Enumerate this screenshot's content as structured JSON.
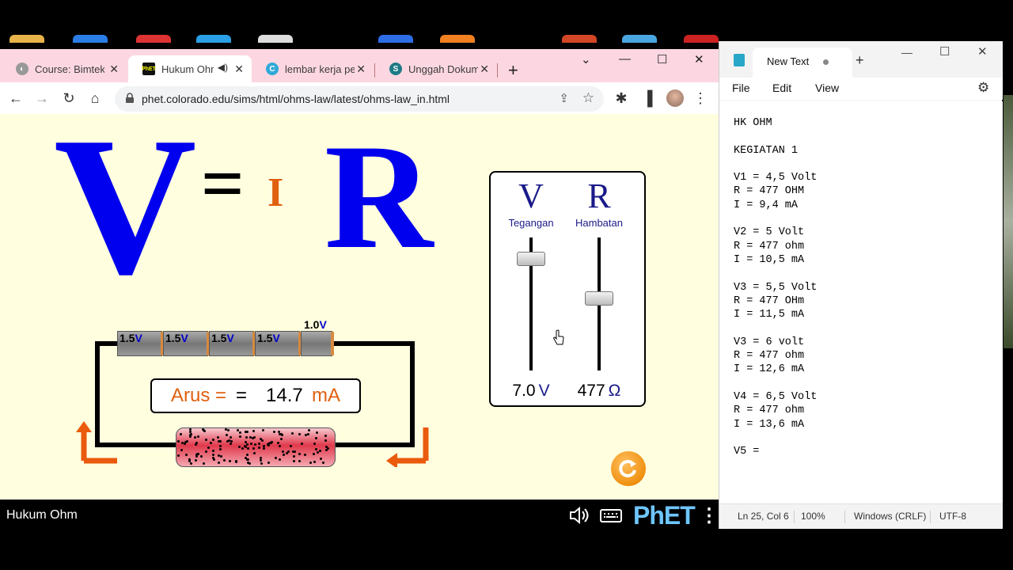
{
  "browser": {
    "tabs": [
      {
        "title": "Course: Bimtek I",
        "favicon": "course-icon",
        "active": false
      },
      {
        "title": "Hukum Ohm",
        "favicon": "phet-icon",
        "active": true,
        "audio": true
      },
      {
        "title": "lembar kerja pe",
        "favicon": "canva-icon",
        "active": false
      },
      {
        "title": "Unggah Dokum",
        "favicon": "scribd-icon",
        "active": false
      }
    ],
    "url": "phet.colorado.edu/sims/html/ohms-law/latest/ohms-law_in.html"
  },
  "sim": {
    "equation": {
      "v": "V",
      "eq": "=",
      "i": "I",
      "r": "R"
    },
    "voltage": {
      "letter": "V",
      "name": "Tegangan",
      "value": "7.0",
      "unit": "V",
      "fraction": 0.84
    },
    "resistance": {
      "letter": "R",
      "name": "Hambatan",
      "value": "477",
      "unit": "Ω",
      "fraction": 0.54
    },
    "batteries": [
      "1.5",
      "1.5",
      "1.5",
      "1.5"
    ],
    "battery_unit": "V",
    "partial_battery": "1.0",
    "current": {
      "label": "Arus =",
      "eq": "=",
      "value": "14.7",
      "unit": "mA"
    },
    "title": "Hukum Ohm",
    "brand": "PhET"
  },
  "notepad": {
    "tab_title": "New Text",
    "menu": [
      "File",
      "Edit",
      "View"
    ],
    "content": "HK OHM\n\nKEGIATAN 1\n\nV1 = 4,5 Volt\nR = 477 OHM\nI = 9,4 mA\n\nV2 = 5 Volt\nR = 477 ohm\nI = 10,5 mA\n\nV3 = 5,5 Volt\nR = 477 OHm\nI = 11,5 mA\n\nV3 = 6 volt\nR = 477 ohm\nI = 12,6 mA\n\nV4 = 6,5 Volt\nR = 477 ohm\nI = 13,6 mA\n\nV5 =",
    "status": {
      "position": "Ln 25, Col 6",
      "zoom": "100%",
      "line_ending": "Windows (CRLF)",
      "encoding": "UTF-8"
    }
  },
  "colors": {
    "accent_blue": "#0000ee",
    "accent_orange": "#e06010",
    "chrome_frame": "#fcd7e2",
    "sim_bg": "#ffffe0"
  }
}
